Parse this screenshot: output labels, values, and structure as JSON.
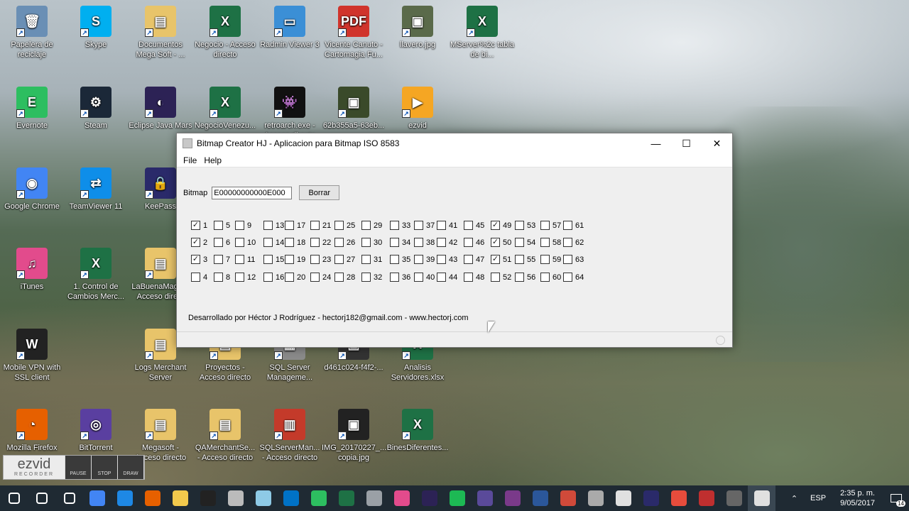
{
  "desktop": {
    "icons": [
      {
        "label": "Papelera de reciclaje",
        "icon": "recycle-bin-icon",
        "color": "#6a8fb5",
        "glyph": "🗑"
      },
      {
        "label": "Skype",
        "icon": "skype-icon",
        "color": "#00aff0",
        "glyph": "S"
      },
      {
        "label": "Documentos Mega Soft - ...",
        "icon": "pdf-folder-icon",
        "color": "#e8c46a",
        "glyph": "▤"
      },
      {
        "label": "Negocio - Acceso directo",
        "icon": "excel-icon",
        "color": "#1e7145",
        "glyph": "X"
      },
      {
        "label": "Radmin Viewer 3",
        "icon": "radmin-icon",
        "color": "#3b8fd6",
        "glyph": "▭"
      },
      {
        "label": "Vicente Canuto - Cartomagia Fu...",
        "icon": "pdf-icon",
        "color": "#d0342c",
        "glyph": "PDF"
      },
      {
        "label": "llavero.jpg",
        "icon": "image-icon",
        "color": "#5a6a4a",
        "glyph": "▣"
      },
      {
        "label": "MServer%2c tabla de bi...",
        "icon": "excel-icon",
        "color": "#1e7145",
        "glyph": "X"
      },
      {
        "label": "Evernote",
        "icon": "evernote-icon",
        "color": "#2dbe60",
        "glyph": "E"
      },
      {
        "label": "Steam",
        "icon": "steam-icon",
        "color": "#1b2838",
        "glyph": "⚙"
      },
      {
        "label": "Eclipse Java Mars",
        "icon": "eclipse-icon",
        "color": "#2c2255",
        "glyph": "◐"
      },
      {
        "label": "NegocioVenezu...",
        "icon": "excel-icon",
        "color": "#1e7145",
        "glyph": "X"
      },
      {
        "label": "retroarch.exe - Acceso directo",
        "icon": "retroarch-icon",
        "color": "#111111",
        "glyph": "👾"
      },
      {
        "label": "62b355a5-63eb...",
        "icon": "image-icon",
        "color": "#3a4a2a",
        "glyph": "▣"
      },
      {
        "label": "ezvid",
        "icon": "ezvid-icon",
        "color": "#f5a623",
        "glyph": "▶"
      },
      {
        "label": "Google Chrome",
        "icon": "chrome-icon",
        "color": "#4285f4",
        "glyph": "◉"
      },
      {
        "label": "TeamViewer 11",
        "icon": "teamviewer-icon",
        "color": "#0e8ee9",
        "glyph": "⇄"
      },
      {
        "label": "KeePass",
        "icon": "keepass-icon",
        "color": "#2a2a6a",
        "glyph": "🔒"
      },
      {
        "label": "iTunes",
        "icon": "itunes-icon",
        "color": "#e24b8c",
        "glyph": "♫"
      },
      {
        "label": "1. Control de Cambios Merc...",
        "icon": "excel-icon",
        "color": "#1e7145",
        "glyph": "X"
      },
      {
        "label": "LaBuenaMag... - Acceso dire...",
        "icon": "folder-icon",
        "color": "#e8c46a",
        "glyph": "▤"
      },
      {
        "label": "Mobile VPN with SSL client",
        "icon": "vpn-icon",
        "color": "#222222",
        "glyph": "W"
      },
      {
        "label": "Logs Merchant Server",
        "icon": "folder-icon",
        "color": "#e8c46a",
        "glyph": "▤"
      },
      {
        "label": "Proyectos - Acceso directo",
        "icon": "folder-icon",
        "color": "#e8c46a",
        "glyph": "▤"
      },
      {
        "label": "SQL Server Manageme...",
        "icon": "sql-icon",
        "color": "#8a8a8a",
        "glyph": "▦"
      },
      {
        "label": "d461c024-f4f2-...",
        "icon": "image-icon",
        "color": "#333333",
        "glyph": "▣"
      },
      {
        "label": "Analisis Servidores.xlsx",
        "icon": "excel-icon",
        "color": "#1e7145",
        "glyph": "X"
      },
      {
        "label": "Mozilla Firefox",
        "icon": "firefox-icon",
        "color": "#e66000",
        "glyph": "◔"
      },
      {
        "label": "BitTorrent",
        "icon": "bittorrent-icon",
        "color": "#5a3fa0",
        "glyph": "◎"
      },
      {
        "label": "Megasoft - Acceso directo",
        "icon": "folder-icon",
        "color": "#e8c46a",
        "glyph": "▤"
      },
      {
        "label": "QAMerchantSe... - Acceso directo",
        "icon": "folder-icon",
        "color": "#e8c46a",
        "glyph": "▤"
      },
      {
        "label": "SQLServerMan... - Acceso directo",
        "icon": "toolbox-icon",
        "color": "#c43a2a",
        "glyph": "▥"
      },
      {
        "label": "IMG_20170227_... copia.jpg",
        "icon": "image-icon",
        "color": "#222222",
        "glyph": "▣"
      },
      {
        "label": "BinesDiferentes...",
        "icon": "excel-icon",
        "color": "#1e7145",
        "glyph": "X"
      }
    ]
  },
  "ezvid": {
    "logo": "ezvid",
    "sub": "RECORDER",
    "pause": "PAUSE",
    "stop": "STOP",
    "draw": "DRAW"
  },
  "window": {
    "title": "Bitmap Creator HJ - Aplicacion para Bitmap ISO 8583",
    "minimize": "—",
    "maximize": "☐",
    "close": "✕",
    "menu": [
      "File",
      "Help"
    ],
    "bitmap_label": "Bitmap",
    "bitmap_value": "E00000000000E000",
    "clear_button": "Borrar",
    "checkboxes": [
      {
        "n": "1",
        "checked": true
      },
      {
        "n": "2",
        "checked": true
      },
      {
        "n": "3",
        "checked": true
      },
      {
        "n": "4",
        "checked": false
      },
      {
        "n": "5",
        "checked": false
      },
      {
        "n": "6",
        "checked": false
      },
      {
        "n": "7",
        "checked": false
      },
      {
        "n": "8",
        "checked": false
      },
      {
        "n": "9",
        "checked": false
      },
      {
        "n": "10",
        "checked": false
      },
      {
        "n": "11",
        "checked": false
      },
      {
        "n": "12",
        "checked": false
      },
      {
        "n": "13",
        "checked": false
      },
      {
        "n": "14",
        "checked": false
      },
      {
        "n": "15",
        "checked": false
      },
      {
        "n": "16",
        "checked": false
      },
      {
        "n": "17",
        "checked": false
      },
      {
        "n": "18",
        "checked": false
      },
      {
        "n": "19",
        "checked": false
      },
      {
        "n": "20",
        "checked": false
      },
      {
        "n": "21",
        "checked": false
      },
      {
        "n": "22",
        "checked": false
      },
      {
        "n": "23",
        "checked": false
      },
      {
        "n": "24",
        "checked": false
      },
      {
        "n": "25",
        "checked": false
      },
      {
        "n": "26",
        "checked": false
      },
      {
        "n": "27",
        "checked": false
      },
      {
        "n": "28",
        "checked": false
      },
      {
        "n": "29",
        "checked": false
      },
      {
        "n": "30",
        "checked": false
      },
      {
        "n": "31",
        "checked": false
      },
      {
        "n": "32",
        "checked": false
      },
      {
        "n": "33",
        "checked": false
      },
      {
        "n": "34",
        "checked": false
      },
      {
        "n": "35",
        "checked": false
      },
      {
        "n": "36",
        "checked": false
      },
      {
        "n": "37",
        "checked": false
      },
      {
        "n": "38",
        "checked": false
      },
      {
        "n": "39",
        "checked": false
      },
      {
        "n": "40",
        "checked": false
      },
      {
        "n": "41",
        "checked": false
      },
      {
        "n": "42",
        "checked": false
      },
      {
        "n": "43",
        "checked": false
      },
      {
        "n": "44",
        "checked": false
      },
      {
        "n": "45",
        "checked": false
      },
      {
        "n": "46",
        "checked": false
      },
      {
        "n": "47",
        "checked": false
      },
      {
        "n": "48",
        "checked": false
      },
      {
        "n": "49",
        "checked": true
      },
      {
        "n": "50",
        "checked": true
      },
      {
        "n": "51",
        "checked": true
      },
      {
        "n": "52",
        "checked": false
      },
      {
        "n": "53",
        "checked": false
      },
      {
        "n": "54",
        "checked": false
      },
      {
        "n": "55",
        "checked": false
      },
      {
        "n": "56",
        "checked": false
      },
      {
        "n": "57",
        "checked": false
      },
      {
        "n": "58",
        "checked": false
      },
      {
        "n": "59",
        "checked": false
      },
      {
        "n": "60",
        "checked": false
      },
      {
        "n": "61",
        "checked": false
      },
      {
        "n": "62",
        "checked": false
      },
      {
        "n": "63",
        "checked": false
      },
      {
        "n": "64",
        "checked": false
      }
    ],
    "footer": "Desarrollado por Héctor J Rodríguez - hectorj182@gmail.com - www.hectorj.com"
  },
  "taskbar": {
    "apps": [
      {
        "icon": "windows-start-icon",
        "color": "#ffffff"
      },
      {
        "icon": "search-icon",
        "color": "#ffffff"
      },
      {
        "icon": "task-view-icon",
        "color": "#ffffff"
      },
      {
        "icon": "chrome-icon",
        "color": "#4285f4"
      },
      {
        "icon": "edge-icon",
        "color": "#1e88e5"
      },
      {
        "icon": "firefox-icon",
        "color": "#e66000"
      },
      {
        "icon": "file-explorer-icon",
        "color": "#f2c94c"
      },
      {
        "icon": "cmd-icon",
        "color": "#222222"
      },
      {
        "icon": "clipboard-icon",
        "color": "#bbbbbb"
      },
      {
        "icon": "notepad-icon",
        "color": "#8ecae6"
      },
      {
        "icon": "outlook-icon",
        "color": "#0072c6"
      },
      {
        "icon": "evernote-icon",
        "color": "#2dbe60"
      },
      {
        "icon": "excel-icon",
        "color": "#1e7145"
      },
      {
        "icon": "tools-icon",
        "color": "#9aa0a6"
      },
      {
        "icon": "itunes-icon",
        "color": "#e24b8c"
      },
      {
        "icon": "eclipse-icon",
        "color": "#2c2255"
      },
      {
        "icon": "spotify-icon",
        "color": "#1db954"
      },
      {
        "icon": "eclipse-mars-icon",
        "color": "#5a4a9a"
      },
      {
        "icon": "winrar-icon",
        "color": "#7a3a8a"
      },
      {
        "icon": "word-icon",
        "color": "#2b579a"
      },
      {
        "icon": "network-icon",
        "color": "#d04a3a"
      },
      {
        "icon": "box-icon",
        "color": "#aaaaaa"
      },
      {
        "icon": "java-icon",
        "color": "#e0e0e0"
      },
      {
        "icon": "keepass-icon",
        "color": "#2a2a6a"
      },
      {
        "icon": "picasa-icon",
        "color": "#e74c3c"
      },
      {
        "icon": "filezilla-icon",
        "color": "#bf2f2f"
      },
      {
        "icon": "calculator-icon",
        "color": "#666666"
      },
      {
        "icon": "java-app-icon",
        "color": "#e0e0e0"
      }
    ],
    "tray_chevron": "⌃",
    "language": "ESP",
    "time": "2:35 p. m.",
    "date": "9/05/2017",
    "notifications": "14"
  }
}
